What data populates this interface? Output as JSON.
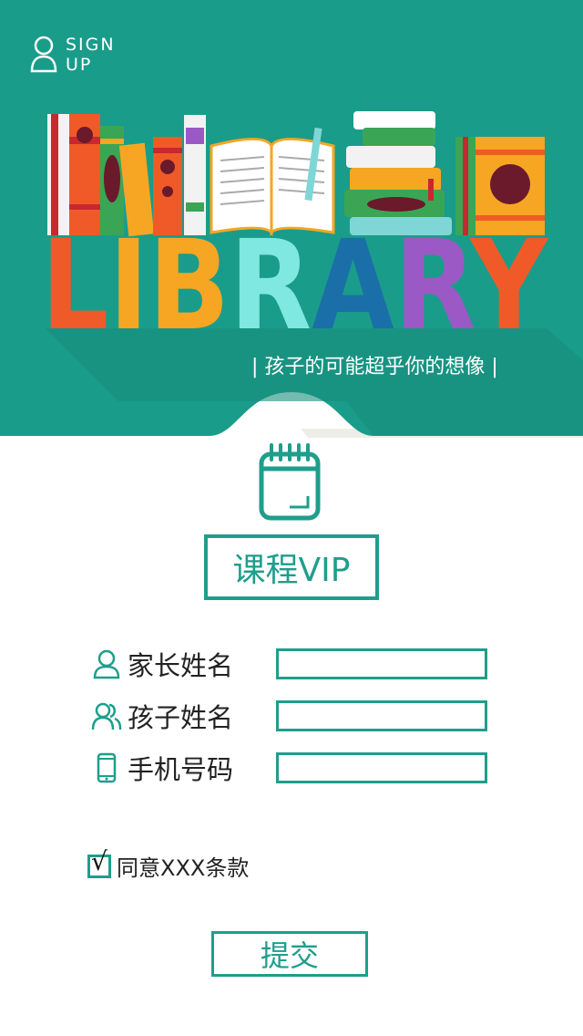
{
  "header": {
    "signup_line1": "SIGN",
    "signup_line2": "UP",
    "user_icon": "user-outline-icon",
    "library_title": "LIBRARY",
    "slogan": "| 孩子的可能超乎你的想像 |",
    "bg_color": "#1a9c8a"
  },
  "card": {
    "icon": "calendar-icon",
    "title": "课程VIP"
  },
  "form": {
    "fields": [
      {
        "icon": "user-icon",
        "label": "家长姓名",
        "value": "",
        "placeholder": ""
      },
      {
        "icon": "users-icon",
        "label": "孩子姓名",
        "value": "",
        "placeholder": ""
      },
      {
        "icon": "mobile-phone-icon",
        "label": "手机号码",
        "value": "",
        "placeholder": ""
      }
    ],
    "agree_check": "√",
    "agree_label": "同意XXX条款",
    "submit_label": "提交"
  },
  "colors": {
    "accent": "#1e9e8c",
    "letters": [
      "#f05a28",
      "#f6a623",
      "#f6a623",
      "#7fe8e0",
      "#1a6fa8",
      "#9b59c6",
      "#f05a28",
      "#c8282f",
      "#f6a623"
    ]
  }
}
